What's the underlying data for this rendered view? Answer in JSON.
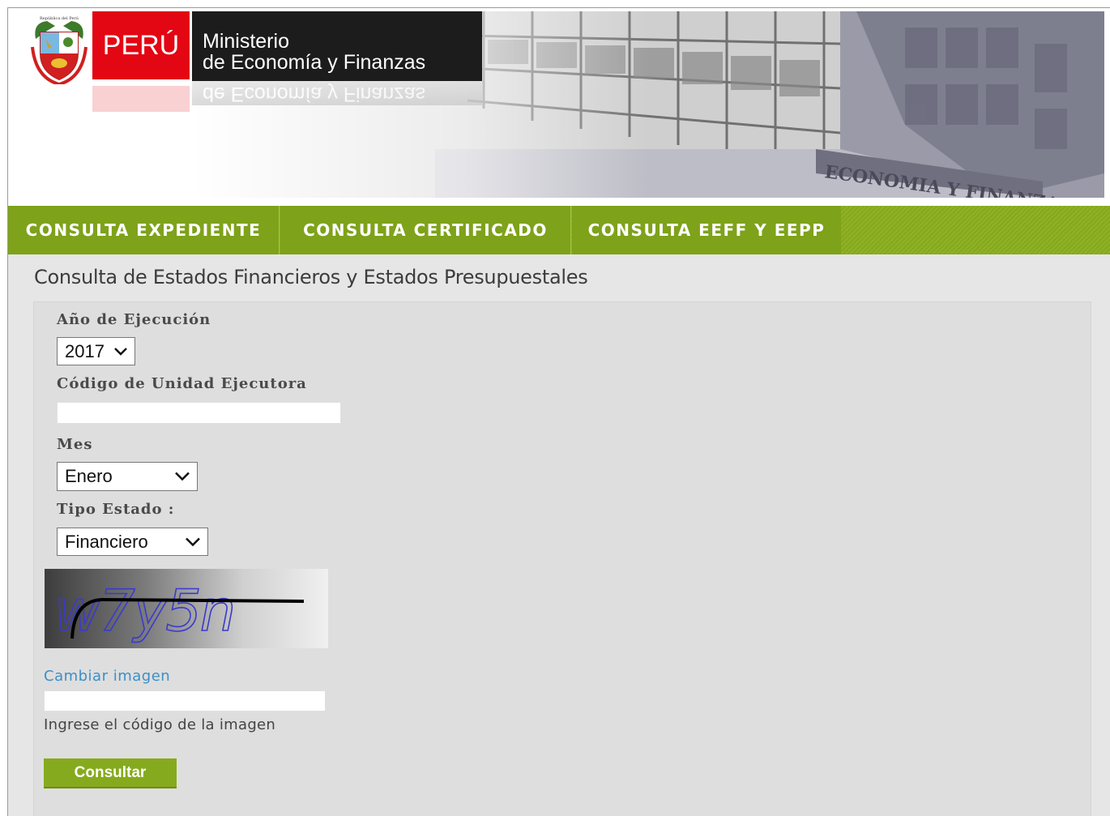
{
  "header": {
    "country_label": "PERÚ",
    "ministry_line1": "Ministerio",
    "ministry_line2": "de Economía y Finanzas",
    "building_sign": "ECONOMIA Y FINANZAS"
  },
  "nav": {
    "items": [
      {
        "label": "CONSULTA EXPEDIENTE"
      },
      {
        "label": "CONSULTA CERTIFICADO"
      },
      {
        "label": "CONSULTA EEFF Y EEPP"
      }
    ]
  },
  "page": {
    "title": "Consulta de Estados Financieros y Estados Presupuestales"
  },
  "form": {
    "year_label": "Año de Ejecución",
    "year_value": "2017",
    "unit_code_label": "Código de Unidad Ejecutora",
    "unit_code_value": "",
    "month_label": "Mes",
    "month_value": "Enero",
    "type_label": "Tipo Estado :",
    "type_value": "Financiero",
    "captcha_text": "w7y5n",
    "change_image_link": "Cambiar imagen",
    "captcha_input_value": "",
    "captcha_hint": "Ingrese el código de la imagen",
    "submit_label": "Consultar"
  },
  "colors": {
    "nav_green": "#86a81f",
    "peru_red": "#e30613",
    "link_blue": "#3e8fc6"
  }
}
